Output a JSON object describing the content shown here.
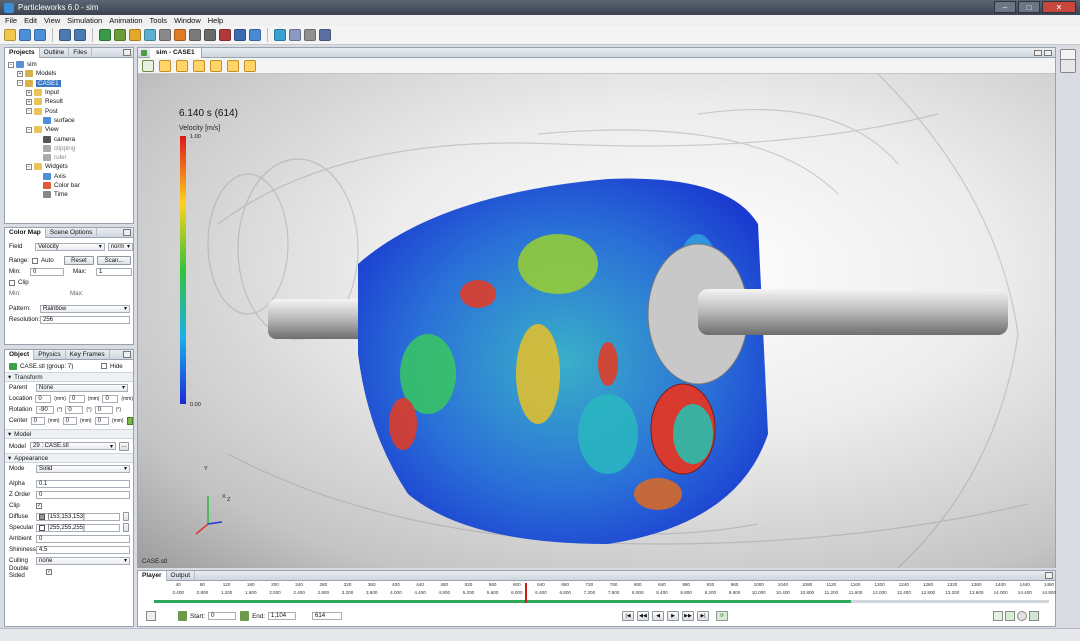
{
  "window": {
    "title": "Particleworks 6.0 - sim",
    "controls": {
      "minimize": "–",
      "maximize": "□",
      "close": "✕"
    }
  },
  "menu": [
    "File",
    "Edit",
    "View",
    "Simulation",
    "Animation",
    "Tools",
    "Window",
    "Help"
  ],
  "toolbar": {
    "icons": [
      "new-file-icon",
      "open-file-icon",
      "save-icon",
      "undo-icon",
      "redo-icon",
      "model-icon",
      "cube-icon",
      "emitter-icon",
      "physics-icon",
      "gear-icon",
      "wall-icon",
      "sphere-icon",
      "camera-icon",
      "film-icon",
      "particles-icon",
      "stack-icon",
      "wave-icon",
      "export-icon",
      "render-icon",
      "gpu-icon"
    ],
    "colors": [
      "#f0c94a",
      "#4f8fd9",
      "#4f8fd9",
      "#4a7ab0",
      "#4a7ab0",
      "#3a9a45",
      "#6a9d3a",
      "#e2a92a",
      "#5ab0d0",
      "#8a8a8a",
      "#e07a24",
      "#7a7a7a",
      "#6a6a6a",
      "#b03a3a",
      "#3a6ab0",
      "#4a8ad0",
      "#3aa0d0",
      "#8a9ac0",
      "#909090",
      "#5a70a0"
    ]
  },
  "projects_panel": {
    "tabs": [
      "Projects",
      "Outline",
      "Files"
    ],
    "tree": [
      {
        "label": "sim",
        "depth": 0,
        "exp": "−",
        "icon": "#5c8fd6",
        "name": "tree-node-sim"
      },
      {
        "label": "Models",
        "depth": 1,
        "exp": "+",
        "icon": "#d8b04a",
        "name": "tree-node-models"
      },
      {
        "label": "CASE1",
        "depth": 1,
        "exp": "−",
        "icon": "#d8b04a",
        "selected": true,
        "name": "tree-node-case1"
      },
      {
        "label": "Input",
        "depth": 2,
        "exp": "+",
        "icon": "#e8c45a",
        "name": "tree-node-input"
      },
      {
        "label": "Result",
        "depth": 2,
        "exp": "+",
        "icon": "#e8c45a",
        "name": "tree-node-result"
      },
      {
        "label": "Post",
        "depth": 2,
        "exp": "−",
        "icon": "#e8c45a",
        "name": "tree-node-post"
      },
      {
        "label": "surface",
        "depth": 3,
        "exp": "",
        "icon": "#4a90d8",
        "name": "tree-node-surface"
      },
      {
        "label": "View",
        "depth": 2,
        "exp": "−",
        "icon": "#e8c45a",
        "name": "tree-node-view"
      },
      {
        "label": "camera",
        "depth": 3,
        "exp": "",
        "icon": "#555555",
        "name": "tree-node-camera"
      },
      {
        "label": "clipping",
        "depth": 3,
        "exp": "",
        "icon": "#aaaaaa",
        "dim": true,
        "name": "tree-node-clipping"
      },
      {
        "label": "ruler",
        "depth": 3,
        "exp": "",
        "icon": "#aaaaaa",
        "dim": true,
        "name": "tree-node-ruler"
      },
      {
        "label": "Widgets",
        "depth": 2,
        "exp": "−",
        "icon": "#e8c45a",
        "name": "tree-node-widgets"
      },
      {
        "label": "Axis",
        "depth": 3,
        "exp": "",
        "icon": "#4a90d8",
        "name": "tree-node-axis"
      },
      {
        "label": "Color bar",
        "depth": 3,
        "exp": "",
        "icon": "#e05a3a",
        "name": "tree-node-colorbar"
      },
      {
        "label": "Time",
        "depth": 3,
        "exp": "",
        "icon": "#888888",
        "name": "tree-node-time"
      }
    ]
  },
  "colormap_panel": {
    "tabs": [
      "Color Map",
      "Scene Options"
    ],
    "field_label": "Field",
    "field_value": "Velocity",
    "norm_value": "norm",
    "range_label": "Range:",
    "auto_label": "Auto",
    "reset_label": "Reset",
    "scan_label": "Scan...",
    "min_label": "Min:",
    "min_value": "0",
    "max_label": "Max:",
    "max_value": "1",
    "clip_label": "Clip",
    "clip_min_label": "Min:",
    "clip_max_label": "Max:",
    "pattern_label": "Pattern:",
    "pattern_value": "Rainbow",
    "resolution_label": "Resolution:",
    "resolution_value": "256"
  },
  "object_panel": {
    "tabs": [
      "Object",
      "Physics",
      "Key Frames"
    ],
    "object_name": "CASE.stl (group: 7)",
    "hide_label": "Hide",
    "transform_label": "Transform",
    "parent_label": "Parent",
    "parent_value": "None",
    "location_label": "Location",
    "location_values": [
      "0",
      "0",
      "0"
    ],
    "rotation_label": "Rotation",
    "rotation_values": [
      "-90",
      "0",
      "0"
    ],
    "center_label": "Center",
    "center_values": [
      "0",
      "0",
      "0"
    ],
    "unit_mm": "(mm)",
    "unit_deg": "(°)",
    "model_section": "Model",
    "model_label": "Model",
    "model_value": "29 : CASE.stl",
    "model_btn": "...",
    "appearance_section": "Appearance",
    "mode_label": "Mode",
    "mode_value": "Solid",
    "alpha_label": "Alpha",
    "alpha_value": "0.1",
    "zorder_label": "Z Order",
    "zorder_value": "0",
    "clip_label": "Clip",
    "diffuse_label": "Diffuse",
    "diffuse_value": "[153,153,153]",
    "diffuse_color": "#999999",
    "specular_label": "Specular",
    "specular_value": "[255,255,255]",
    "specular_color": "#ffffff",
    "ambient_label": "Ambient",
    "ambient_value": "0",
    "shininess_label": "Shininess",
    "shininess_value": "4.5",
    "culling_label": "Culling",
    "culling_value": "none",
    "double_sided_label": "Double Sided"
  },
  "viewport": {
    "tab_label": "sim - CASE1",
    "sim_time": "6.140 s (614)",
    "colorbar_title": "Velocity [m/s]",
    "colorbar_max": "1.00",
    "colorbar_min": "0.00",
    "case_label": "CASE.stl",
    "axis_labels": [
      "Y",
      "X",
      "Z"
    ]
  },
  "player": {
    "tabs": [
      "Player",
      "Output"
    ],
    "ticks_top": [
      "40",
      "80",
      "120",
      "160",
      "200",
      "240",
      "280",
      "320",
      "360",
      "400",
      "440",
      "480",
      "520",
      "560",
      "600",
      "640",
      "680",
      "720",
      "760",
      "800",
      "840",
      "880",
      "920",
      "960",
      "1000",
      "1040",
      "1080",
      "1120",
      "1160",
      "1200",
      "1240",
      "1280",
      "1320",
      "1360",
      "1400",
      "1440",
      "1480"
    ],
    "ticks_bottom": [
      "0.400",
      "0.800",
      "1.200",
      "1.600",
      "2.000",
      "2.400",
      "2.800",
      "3.200",
      "3.600",
      "4.000",
      "4.400",
      "4.800",
      "5.200",
      "5.600",
      "6.000",
      "6.400",
      "6.800",
      "7.200",
      "7.600",
      "8.000",
      "8.400",
      "8.800",
      "9.200",
      "9.600",
      "10.000",
      "10.400",
      "10.800",
      "11.200",
      "11.600",
      "12.000",
      "12.400",
      "12.800",
      "13.200",
      "13.600",
      "14.000",
      "14.400",
      "14.800"
    ],
    "tick_count_total": 37,
    "current_frame": 614,
    "max_frame": 1480,
    "loaded_frames": 1152,
    "start_label": "Start:",
    "start_value": "0",
    "end_label": "End:",
    "end_value": "1,104",
    "frame_value": "614",
    "buttons": [
      "|◀",
      "◀◀",
      "◀",
      "▶",
      "▶▶",
      "▶|",
      "⟳"
    ]
  }
}
